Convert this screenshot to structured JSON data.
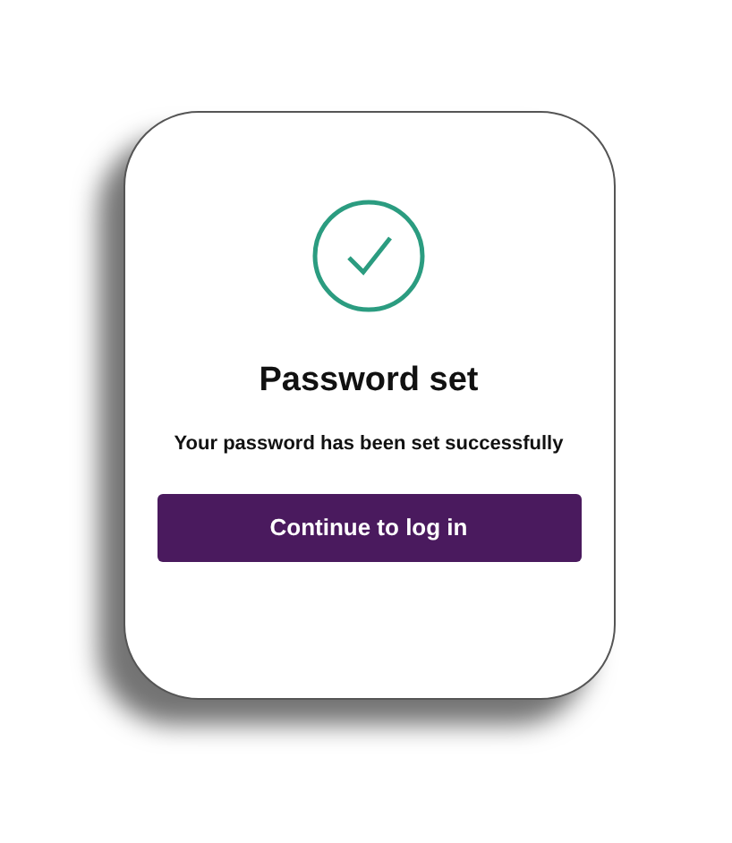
{
  "dialog": {
    "title": "Password set",
    "message": "Your password has been set successfully",
    "button": "Continue to log in"
  }
}
